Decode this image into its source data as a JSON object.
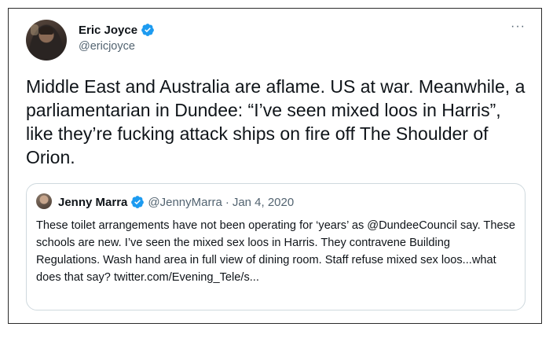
{
  "tweet": {
    "author_name": "Eric Joyce",
    "author_handle": "@ericjoyce",
    "verified_icon": "verified-badge-icon",
    "more_icon": "more-options-icon",
    "more_label": "···",
    "text": "Middle East and Australia are aflame. US at war. Meanwhile, a parliamentarian in Dundee: “I’ve seen mixed loos in Harris”, like they’re fucking attack ships on fire off The Shoulder of Orion."
  },
  "quoted_tweet": {
    "author_name": "Jenny Marra",
    "author_handle": "@JennyMarra",
    "separator": "·",
    "date": "Jan 4, 2020",
    "text": "These toilet arrangements have not been operating for ‘years’ as @DundeeCouncil say. These schools are new. I’ve seen the mixed sex loos in Harris. They contravene Building Regulations. Wash hand area in full view of dining room. Staff refuse mixed sex loos...what does that say? twitter.com/Evening_Tele/s..."
  },
  "colors": {
    "verified_blue": "#1d9bf0",
    "text_primary": "#0f1419",
    "text_secondary": "#536471",
    "quote_border": "#cfd9de"
  }
}
